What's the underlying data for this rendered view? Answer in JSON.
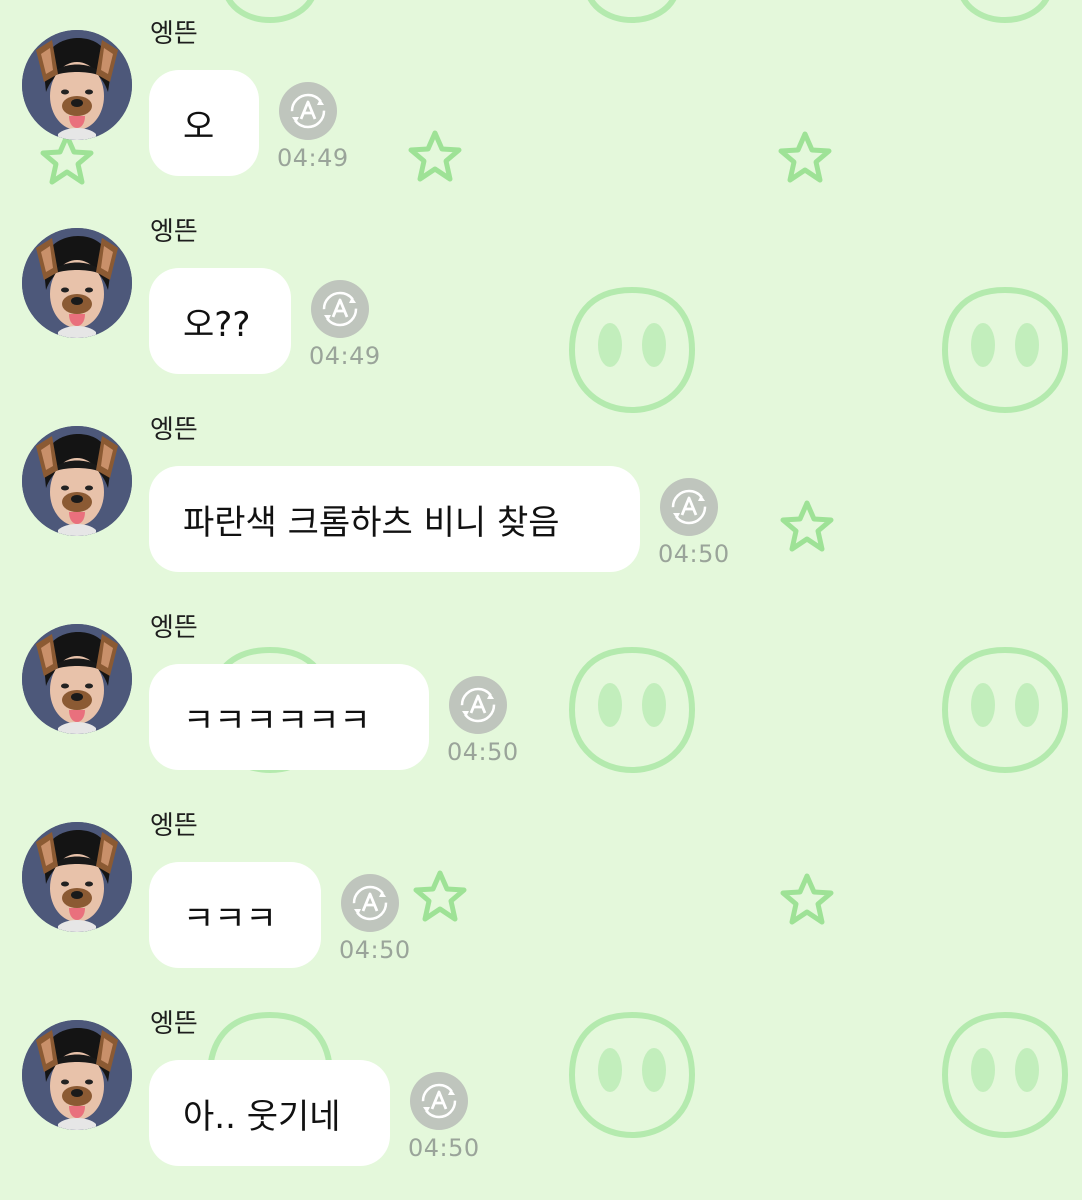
{
  "chat": {
    "messages": [
      {
        "sender": "엥뜬",
        "text": "오",
        "time": "04:49"
      },
      {
        "sender": "엥뜬",
        "text": "오??",
        "time": "04:49"
      },
      {
        "sender": "엥뜬",
        "text": "파란색 크롬하츠 비니 찾음",
        "time": "04:50"
      },
      {
        "sender": "엥뜬",
        "text": "ㅋㅋㅋㅋㅋㅋ",
        "time": "04:50"
      },
      {
        "sender": "엥뜬",
        "text": "ㅋㅋㅋ",
        "time": "04:50"
      },
      {
        "sender": "엥뜬",
        "text": "아.. 웃기네",
        "time": "04:50"
      }
    ]
  },
  "icons": {
    "translate": "translate-icon",
    "background": [
      "star-icon",
      "alien-face-icon"
    ]
  },
  "colors": {
    "background": "#e4f8db",
    "bubble": "#ffffff",
    "pattern": "#a9e6a2",
    "time_text": "#9aa49a"
  }
}
